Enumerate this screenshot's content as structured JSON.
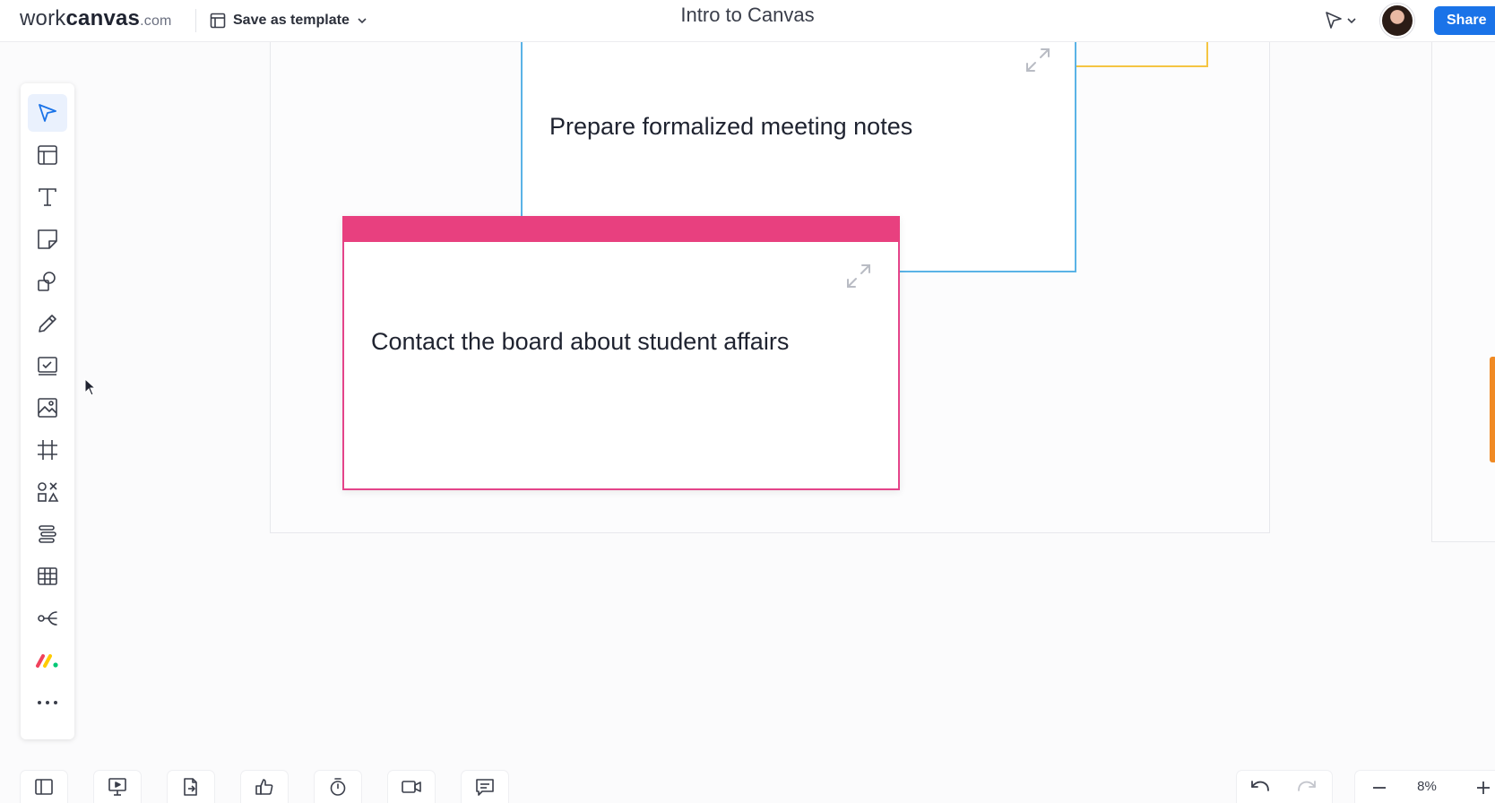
{
  "header": {
    "logo": {
      "part1": "work",
      "part2": "canvas",
      "part3": ".com"
    },
    "template_label": "Save as template",
    "title": "Intro to Canvas",
    "share_label": "Share"
  },
  "canvas": {
    "cards": [
      {
        "text": "Prepare formalized meeting notes",
        "color": "#5ab3e6"
      },
      {
        "text": "Contact the board about student affairs",
        "color": "#e8407f"
      }
    ],
    "partial_card_colors": [
      "#f5c542",
      "#f08a24"
    ]
  },
  "toolbar": {
    "tools": [
      {
        "icon": "select-arrow-icon",
        "active": true
      },
      {
        "icon": "layout-icon"
      },
      {
        "icon": "text-icon"
      },
      {
        "icon": "sticky-note-icon"
      },
      {
        "icon": "shapes-icon"
      },
      {
        "icon": "pen-icon"
      },
      {
        "icon": "task-checkbox-icon"
      },
      {
        "icon": "image-icon"
      },
      {
        "icon": "frame-icon"
      },
      {
        "icon": "elements-icon"
      },
      {
        "icon": "align-list-icon"
      },
      {
        "icon": "table-icon"
      },
      {
        "icon": "mind-map-icon"
      },
      {
        "icon": "monday-logo-icon"
      },
      {
        "icon": "more-icon"
      }
    ]
  },
  "bottom": {
    "buttons": [
      "panel-toggle-icon",
      "present-icon",
      "export-icon",
      "vote-icon",
      "timer-icon",
      "video-icon",
      "comment-icon"
    ],
    "zoom_level": "8%"
  },
  "colors": {
    "accent": "#1a73e8",
    "pink": "#e8407f",
    "blue": "#5ab3e6",
    "yellow": "#f5c542",
    "orange": "#f08a24"
  }
}
